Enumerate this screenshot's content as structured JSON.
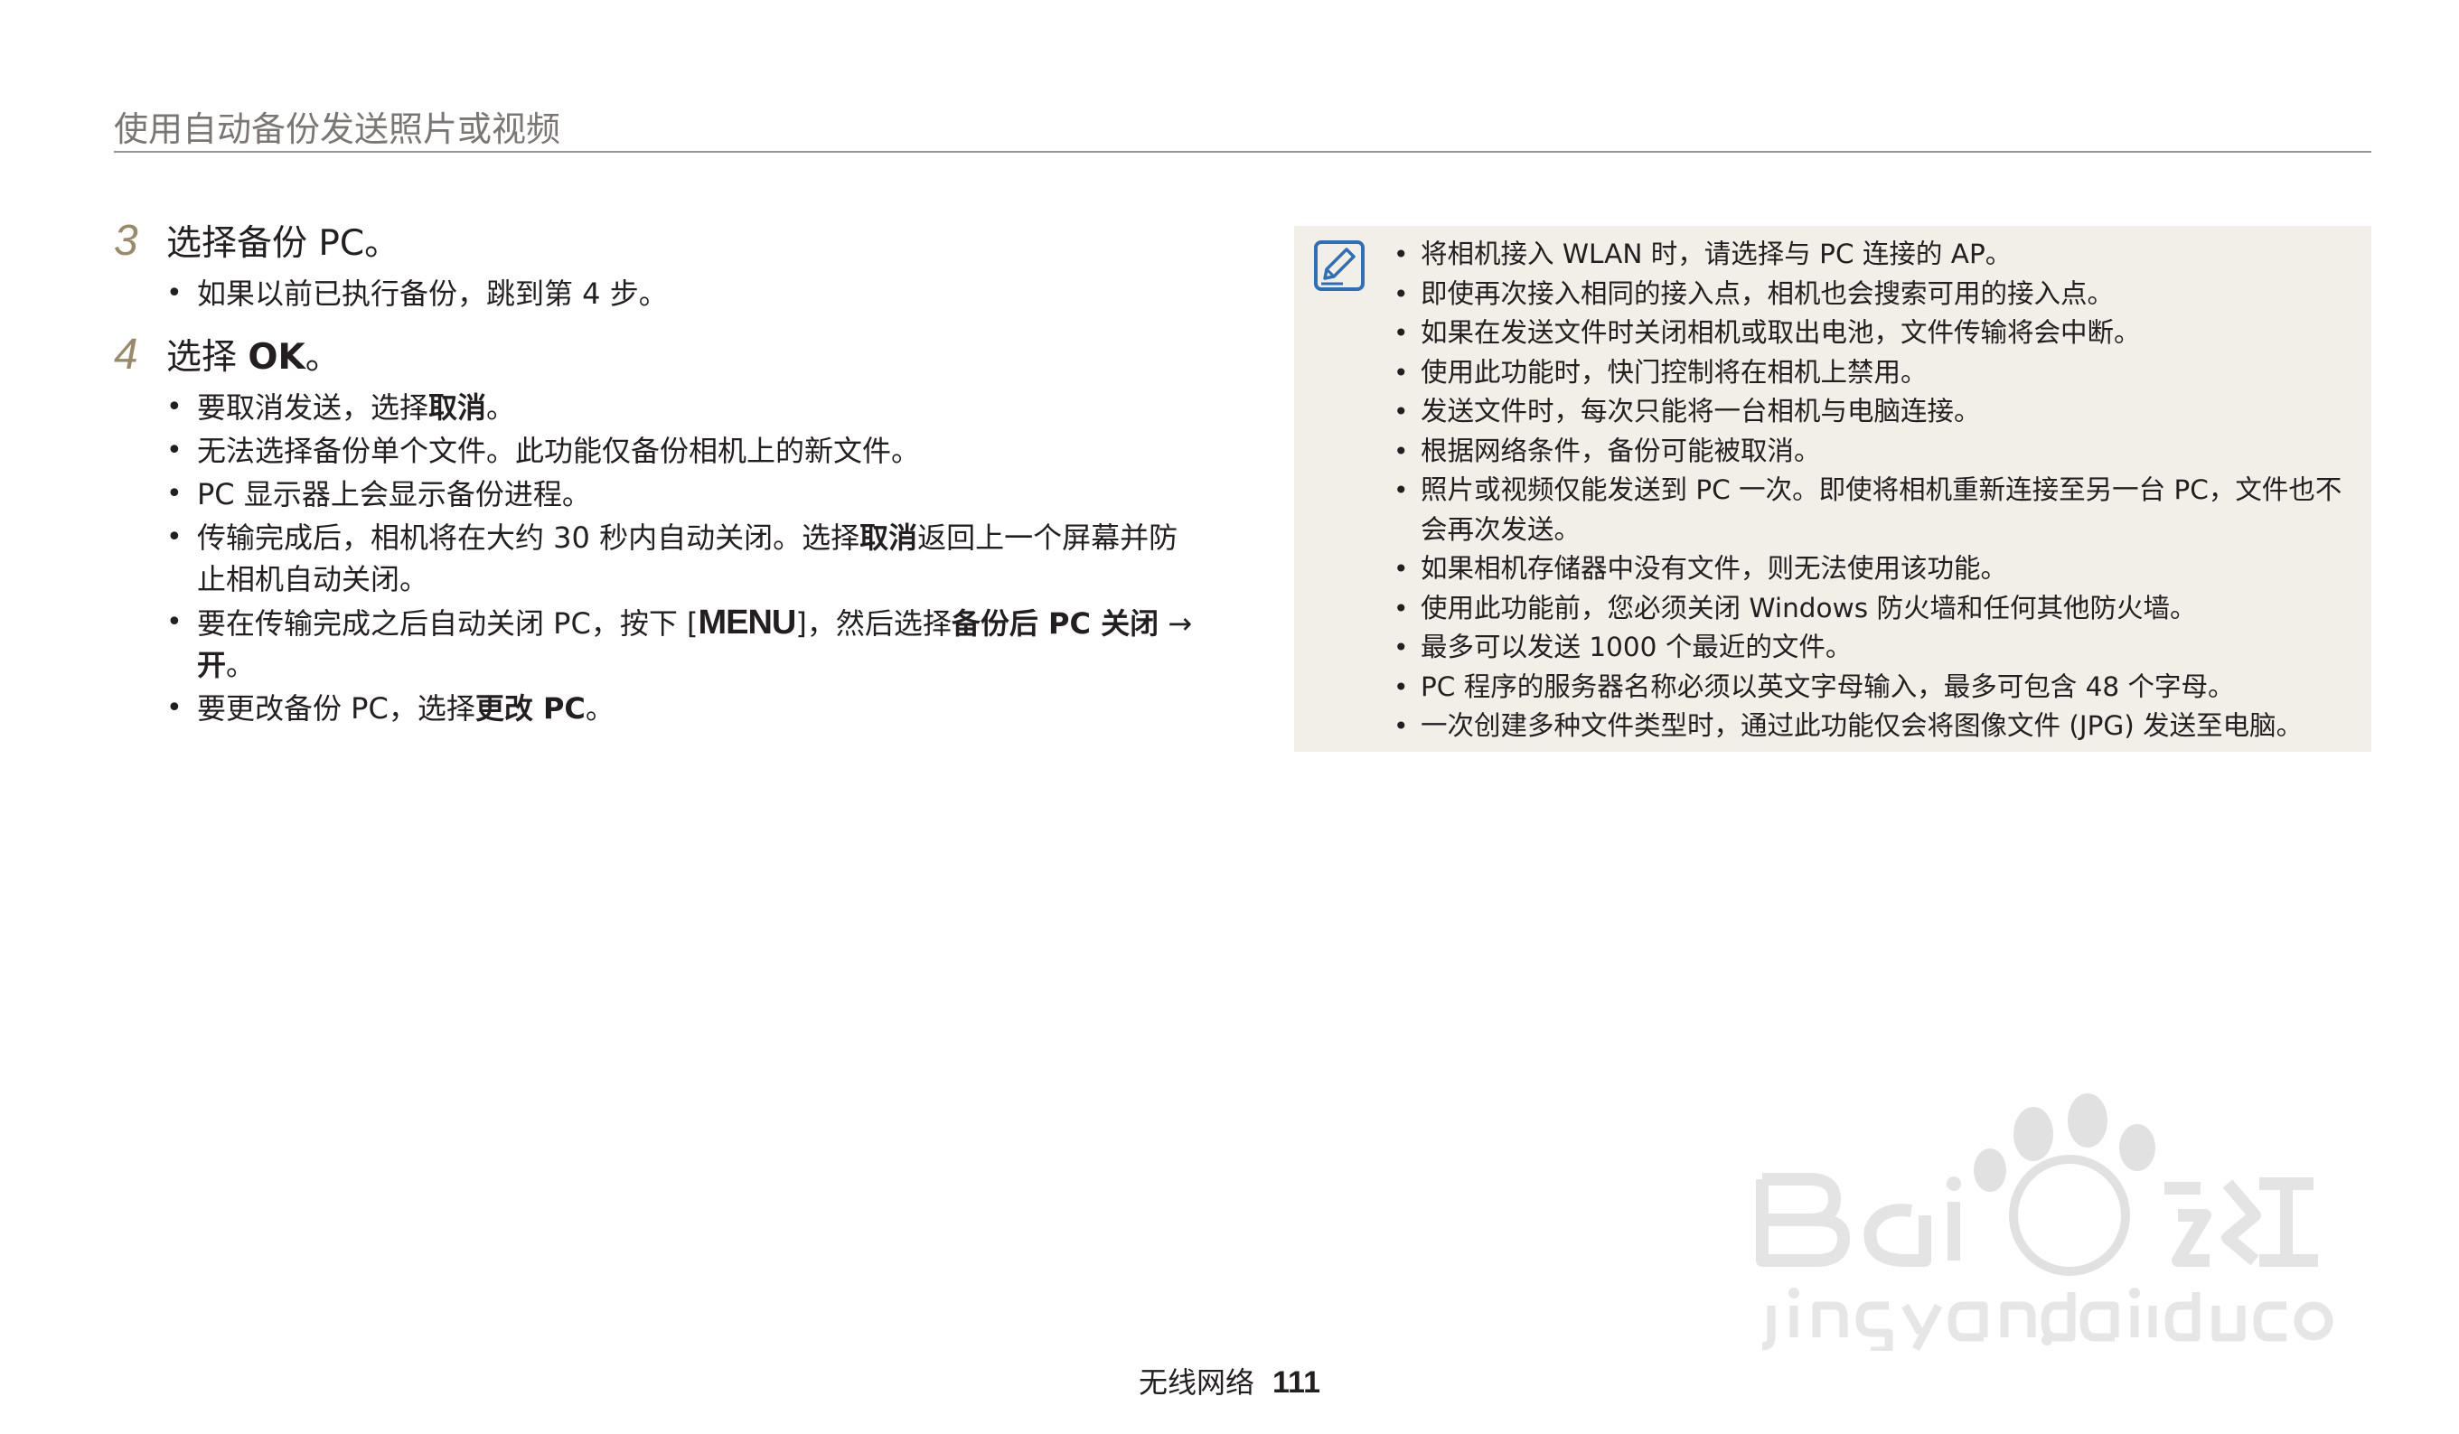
{
  "header": {
    "title": "使用自动备份发送照片或视频"
  },
  "steps": [
    {
      "number": "3",
      "text": "选择备份 PC。",
      "bullets": [
        {
          "parts": [
            {
              "t": "如果以前已执行备份，跳到第 4 步。"
            }
          ]
        }
      ]
    },
    {
      "number": "4",
      "text_pre": "选择 ",
      "text_bold": "OK",
      "text_post": "。",
      "bullets": [
        {
          "parts": [
            {
              "t": "要取消发送，选择"
            },
            {
              "t": "取消",
              "b": true
            },
            {
              "t": "。"
            }
          ]
        },
        {
          "parts": [
            {
              "t": "无法选择备份单个文件。此功能仅备份相机上的新文件。"
            }
          ]
        },
        {
          "parts": [
            {
              "t": "PC 显示器上会显示备份进程。"
            }
          ]
        },
        {
          "parts": [
            {
              "t": "传输完成后，相机将在大约 30 秒内自动关闭。选择"
            },
            {
              "t": "取消",
              "b": true
            },
            {
              "t": "返回上一个屏幕并防止相机自动关闭。"
            }
          ]
        },
        {
          "parts": [
            {
              "t": "要在传输完成之后自动关闭 PC，按下 ["
            },
            {
              "t": "MENU",
              "key": true
            },
            {
              "t": "]，然后选择"
            },
            {
              "t": "备份后 PC 关闭",
              "b": true
            },
            {
              "t": " → "
            },
            {
              "t": "开",
              "b": true
            },
            {
              "t": "。"
            }
          ]
        },
        {
          "parts": [
            {
              "t": "要更改备份 PC，选择"
            },
            {
              "t": "更改 PC",
              "b": true
            },
            {
              "t": "。"
            }
          ]
        }
      ]
    }
  ],
  "note": {
    "icon": "note-pencil-icon",
    "items": [
      "将相机接入 WLAN 时，请选择与 PC 连接的 AP。",
      "即使再次接入相同的接入点，相机也会搜索可用的接入点。",
      "如果在发送文件时关闭相机或取出电池，文件传输将会中断。",
      "使用此功能时，快门控制将在相机上禁用。",
      "发送文件时，每次只能将一台相机与电脑连接。",
      "根据网络条件，备份可能被取消。",
      "照片或视频仅能发送到 PC 一次。即使将相机重新连接至另一台 PC，文件也不会再次发送。",
      "如果相机存储器中没有文件，则无法使用该功能。",
      "使用此功能前，您必须关闭 Windows 防火墙和任何其他防火墙。",
      "最多可以发送 1000 个最近的文件。",
      "PC 程序的服务器名称必须以英文字母输入，最多可包含 48 个字母。",
      "一次创建多种文件类型时，通过此功能仅会将图像文件 (JPG) 发送至电脑。"
    ]
  },
  "footer": {
    "section": "无线网络",
    "page": "111"
  },
  "watermark": {
    "brand": "Baidu经验",
    "url": "jingyan.baidu.com"
  },
  "colors": {
    "step_number": "#9b8a6a",
    "note_bg": "#f2efe9",
    "icon_blue": "#2f6fb6"
  }
}
